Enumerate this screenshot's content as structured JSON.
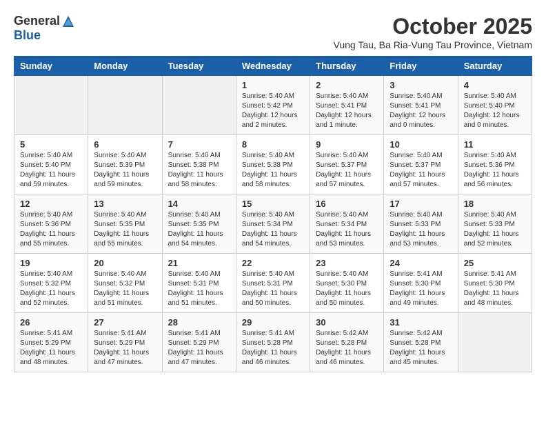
{
  "logo": {
    "general": "General",
    "blue": "Blue"
  },
  "title": "October 2025",
  "location": "Vung Tau, Ba Ria-Vung Tau Province, Vietnam",
  "days_of_week": [
    "Sunday",
    "Monday",
    "Tuesday",
    "Wednesday",
    "Thursday",
    "Friday",
    "Saturday"
  ],
  "weeks": [
    [
      {
        "day": "",
        "info": ""
      },
      {
        "day": "",
        "info": ""
      },
      {
        "day": "",
        "info": ""
      },
      {
        "day": "1",
        "info": "Sunrise: 5:40 AM\nSunset: 5:42 PM\nDaylight: 12 hours\nand 2 minutes."
      },
      {
        "day": "2",
        "info": "Sunrise: 5:40 AM\nSunset: 5:41 PM\nDaylight: 12 hours\nand 1 minute."
      },
      {
        "day": "3",
        "info": "Sunrise: 5:40 AM\nSunset: 5:41 PM\nDaylight: 12 hours\nand 0 minutes."
      },
      {
        "day": "4",
        "info": "Sunrise: 5:40 AM\nSunset: 5:40 PM\nDaylight: 12 hours\nand 0 minutes."
      }
    ],
    [
      {
        "day": "5",
        "info": "Sunrise: 5:40 AM\nSunset: 5:40 PM\nDaylight: 11 hours\nand 59 minutes."
      },
      {
        "day": "6",
        "info": "Sunrise: 5:40 AM\nSunset: 5:39 PM\nDaylight: 11 hours\nand 59 minutes."
      },
      {
        "day": "7",
        "info": "Sunrise: 5:40 AM\nSunset: 5:38 PM\nDaylight: 11 hours\nand 58 minutes."
      },
      {
        "day": "8",
        "info": "Sunrise: 5:40 AM\nSunset: 5:38 PM\nDaylight: 11 hours\nand 58 minutes."
      },
      {
        "day": "9",
        "info": "Sunrise: 5:40 AM\nSunset: 5:37 PM\nDaylight: 11 hours\nand 57 minutes."
      },
      {
        "day": "10",
        "info": "Sunrise: 5:40 AM\nSunset: 5:37 PM\nDaylight: 11 hours\nand 57 minutes."
      },
      {
        "day": "11",
        "info": "Sunrise: 5:40 AM\nSunset: 5:36 PM\nDaylight: 11 hours\nand 56 minutes."
      }
    ],
    [
      {
        "day": "12",
        "info": "Sunrise: 5:40 AM\nSunset: 5:36 PM\nDaylight: 11 hours\nand 55 minutes."
      },
      {
        "day": "13",
        "info": "Sunrise: 5:40 AM\nSunset: 5:35 PM\nDaylight: 11 hours\nand 55 minutes."
      },
      {
        "day": "14",
        "info": "Sunrise: 5:40 AM\nSunset: 5:35 PM\nDaylight: 11 hours\nand 54 minutes."
      },
      {
        "day": "15",
        "info": "Sunrise: 5:40 AM\nSunset: 5:34 PM\nDaylight: 11 hours\nand 54 minutes."
      },
      {
        "day": "16",
        "info": "Sunrise: 5:40 AM\nSunset: 5:34 PM\nDaylight: 11 hours\nand 53 minutes."
      },
      {
        "day": "17",
        "info": "Sunrise: 5:40 AM\nSunset: 5:33 PM\nDaylight: 11 hours\nand 53 minutes."
      },
      {
        "day": "18",
        "info": "Sunrise: 5:40 AM\nSunset: 5:33 PM\nDaylight: 11 hours\nand 52 minutes."
      }
    ],
    [
      {
        "day": "19",
        "info": "Sunrise: 5:40 AM\nSunset: 5:32 PM\nDaylight: 11 hours\nand 52 minutes."
      },
      {
        "day": "20",
        "info": "Sunrise: 5:40 AM\nSunset: 5:32 PM\nDaylight: 11 hours\nand 51 minutes."
      },
      {
        "day": "21",
        "info": "Sunrise: 5:40 AM\nSunset: 5:31 PM\nDaylight: 11 hours\nand 51 minutes."
      },
      {
        "day": "22",
        "info": "Sunrise: 5:40 AM\nSunset: 5:31 PM\nDaylight: 11 hours\nand 50 minutes."
      },
      {
        "day": "23",
        "info": "Sunrise: 5:40 AM\nSunset: 5:30 PM\nDaylight: 11 hours\nand 50 minutes."
      },
      {
        "day": "24",
        "info": "Sunrise: 5:41 AM\nSunset: 5:30 PM\nDaylight: 11 hours\nand 49 minutes."
      },
      {
        "day": "25",
        "info": "Sunrise: 5:41 AM\nSunset: 5:30 PM\nDaylight: 11 hours\nand 48 minutes."
      }
    ],
    [
      {
        "day": "26",
        "info": "Sunrise: 5:41 AM\nSunset: 5:29 PM\nDaylight: 11 hours\nand 48 minutes."
      },
      {
        "day": "27",
        "info": "Sunrise: 5:41 AM\nSunset: 5:29 PM\nDaylight: 11 hours\nand 47 minutes."
      },
      {
        "day": "28",
        "info": "Sunrise: 5:41 AM\nSunset: 5:29 PM\nDaylight: 11 hours\nand 47 minutes."
      },
      {
        "day": "29",
        "info": "Sunrise: 5:41 AM\nSunset: 5:28 PM\nDaylight: 11 hours\nand 46 minutes."
      },
      {
        "day": "30",
        "info": "Sunrise: 5:42 AM\nSunset: 5:28 PM\nDaylight: 11 hours\nand 46 minutes."
      },
      {
        "day": "31",
        "info": "Sunrise: 5:42 AM\nSunset: 5:28 PM\nDaylight: 11 hours\nand 45 minutes."
      },
      {
        "day": "",
        "info": ""
      }
    ]
  ]
}
